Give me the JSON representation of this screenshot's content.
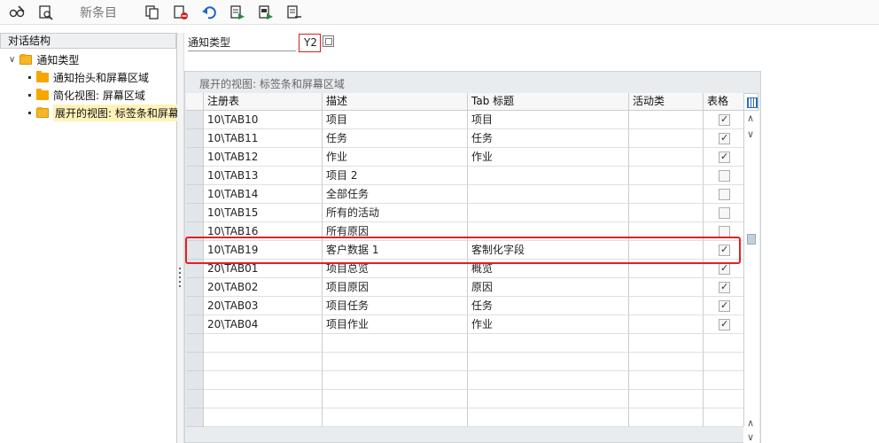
{
  "toolbar": {
    "new_entries_label": "新条目",
    "icons": [
      "glasses-edit-icon",
      "display-change-icon",
      "copy-icon",
      "delete-icon",
      "undo-icon",
      "select-all-icon",
      "select-block-icon",
      "deselect-icon"
    ]
  },
  "left_panel": {
    "title": "对话结构",
    "tree": {
      "root": "通知类型",
      "children": [
        {
          "label": "通知抬头和屏幕区域"
        },
        {
          "label": "简化视图: 屏幕区域"
        },
        {
          "label": "展开的视图: 标签条和屏幕"
        }
      ]
    }
  },
  "header_field": {
    "label": "通知类型",
    "value": "Y2"
  },
  "grid": {
    "title": "展开的视图: 标签条和屏幕区域",
    "columns": [
      "注册表",
      "描述",
      "Tab 标题",
      "活动类",
      "表格"
    ],
    "rows": [
      {
        "reg": "10\\TAB10",
        "desc": "项目",
        "tab": "项目",
        "act": "",
        "table": true
      },
      {
        "reg": "10\\TAB11",
        "desc": "任务",
        "tab": "任务",
        "act": "",
        "table": true
      },
      {
        "reg": "10\\TAB12",
        "desc": "作业",
        "tab": "作业",
        "act": "",
        "table": true
      },
      {
        "reg": "10\\TAB13",
        "desc": "项目 2",
        "tab": "",
        "act": "",
        "table": false
      },
      {
        "reg": "10\\TAB14",
        "desc": "全部任务",
        "tab": "",
        "act": "",
        "table": false
      },
      {
        "reg": "10\\TAB15",
        "desc": "所有的活动",
        "tab": "",
        "act": "",
        "table": false
      },
      {
        "reg": "10\\TAB16",
        "desc": "所有原因",
        "tab": "",
        "act": "",
        "table": false
      },
      {
        "reg": "10\\TAB19",
        "desc": "客户数据 1",
        "tab": "客制化字段",
        "act": "",
        "table": true
      },
      {
        "reg": "20\\TAB01",
        "desc": "项目总览",
        "tab": "概览",
        "act": "",
        "table": true
      },
      {
        "reg": "20\\TAB02",
        "desc": "项目原因",
        "tab": "原因",
        "act": "",
        "table": true
      },
      {
        "reg": "20\\TAB03",
        "desc": "项目任务",
        "tab": "任务",
        "act": "",
        "table": true
      },
      {
        "reg": "20\\TAB04",
        "desc": "项目作业",
        "tab": "作业",
        "act": "",
        "table": true
      }
    ]
  },
  "colors": {
    "accent": "#e12222",
    "folder": "#f5a700",
    "selection": "#fff3b8",
    "grid_bg": "#e9ecef"
  }
}
